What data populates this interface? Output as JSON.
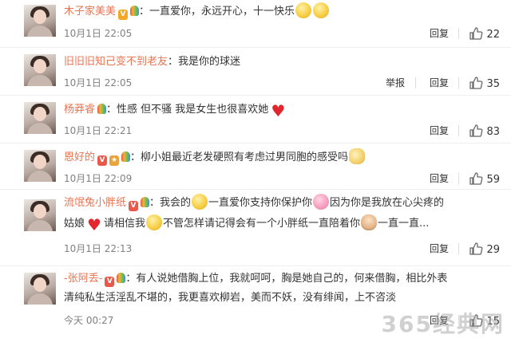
{
  "comments": [
    {
      "username": "木子家美美",
      "text": "：一直爱你，永远开心，十一快乐",
      "time": "10月1日 22:05",
      "reply_label": "回复",
      "likes": "22"
    },
    {
      "username": "旧旧旧知己变不到老友",
      "text": "：我是你的球迷",
      "time": "10月1日 22:05",
      "report_label": "举报",
      "reply_label": "回复",
      "likes": "35"
    },
    {
      "username": "杨莽睿",
      "text": "：性感 但不骚 我是女生也很喜欢她",
      "time": "10月1日 22:21",
      "reply_label": "回复",
      "likes": "83"
    },
    {
      "username": "恩好的",
      "text": "：柳小姐最近老发硬照有考虑过男同胞的感受吗",
      "time": "10月1日 22:09",
      "reply_label": "回复",
      "likes": "59"
    },
    {
      "username": "流氓兔小胖纸",
      "text_a": "：我会的",
      "text_b": "一直爱你支持你保护你",
      "text_c": "因为你是我放在心尖疼的",
      "text_d": "姑娘",
      "text_e": "请相信我",
      "text_f": "不管怎样请记得会有一个小胖纸一直陪着你",
      "text_g": "一直一直...",
      "time": "10月1日 22:13",
      "reply_label": "回复",
      "likes": "29"
    },
    {
      "username": "-张阿丢-",
      "text_a": "：有人说她借胸上位，我就呵呵，胸是她自己的，何来借胸，相比外表",
      "text_b": "清纯私生活淫乱不堪的，我更喜欢柳岩，美而不妖，没有绯闻，",
      "text_c": "上不咨淡",
      "time": "今天 00:27",
      "reply_label": "回复",
      "likes": "15"
    }
  ],
  "icons": {
    "verified": "v-badge-icon",
    "rainbow": "rainbow-bulb-icon",
    "like": "thumb-up-icon"
  },
  "colors": {
    "username": "#eb7350",
    "time": "#808080",
    "text": "#333333"
  },
  "watermark": "365经典网"
}
